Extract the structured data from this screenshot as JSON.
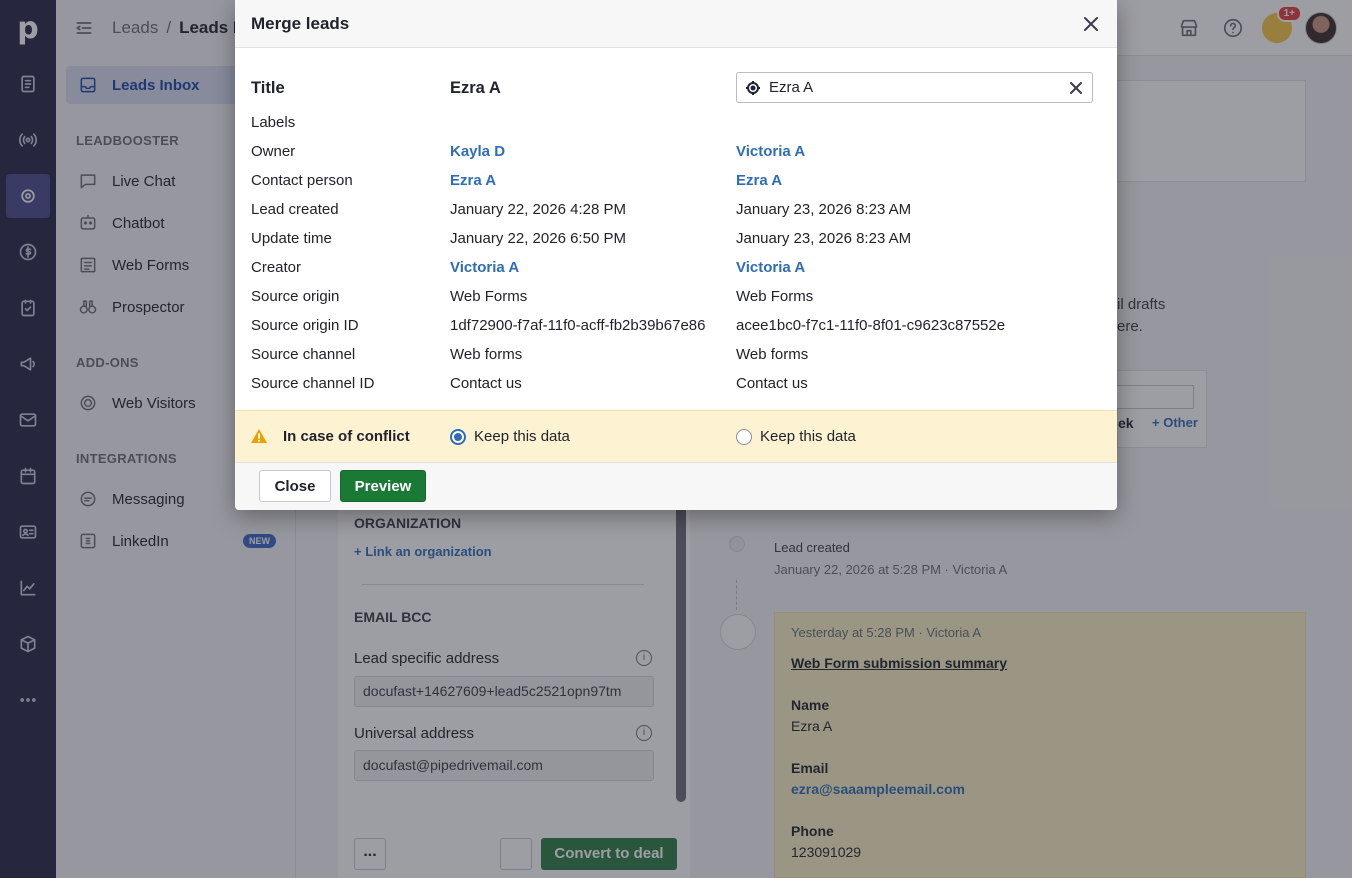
{
  "app": {
    "logo": "p",
    "breadcrumb": {
      "parent": "Leads",
      "separator": "/",
      "current": "Leads In"
    },
    "notification_count": "1+"
  },
  "sidebar": {
    "inbox": "Leads Inbox",
    "leadbooster_title": "LEADBOOSTER",
    "leadbooster_items": [
      "Live Chat",
      "Chatbot",
      "Web Forms",
      "Prospector"
    ],
    "addons_title": "ADD-ONS",
    "addons_items": [
      "Web Visitors"
    ],
    "integrations_title": "INTEGRATIONS",
    "integrations_items": [
      "Messaging",
      "LinkedIn"
    ],
    "new_badge": "NEW"
  },
  "background": {
    "organization_title": "ORGANIZATION",
    "link_org": "+ Link an organization",
    "email_bcc_title": "EMAIL BCC",
    "lead_specific_label": "Lead specific address",
    "lead_specific_value": "docufast+14627609+lead5c2521opn97tm",
    "universal_label": "Universal address",
    "universal_value": "docufast@pipedrivemail.com",
    "more_button": "...",
    "convert_button": "Convert to deal",
    "drafts_text_1": "il drafts",
    "drafts_text_2": "ere.",
    "week_button": "ek",
    "other_link": "+ Other",
    "lead_created_label": "Lead created",
    "lead_created_meta": "January 22, 2026 at 5:28 PM · Victoria A",
    "note_meta": "Yesterday at 5:28 PM · Victoria A",
    "note_title": "Web Form submission summary",
    "name_label": "Name",
    "name_value": "Ezra A",
    "email_label": "Email",
    "email_value": "ezra@saaampleemail.com",
    "phone_label": "Phone",
    "phone_value": "123091029"
  },
  "modal": {
    "title": "Merge leads",
    "search_value": "Ezra A",
    "rows": [
      {
        "label": "Title",
        "left": "Ezra A",
        "right": ""
      },
      {
        "label": "Labels",
        "left": "",
        "right": ""
      },
      {
        "label": "Owner",
        "left": "Kayla D",
        "right": "Victoria A"
      },
      {
        "label": "Contact person",
        "left": "Ezra A",
        "right": "Ezra A"
      },
      {
        "label": "Lead created",
        "left": "January 22, 2026 4:28 PM",
        "right": "January 23, 2026 8:23 AM"
      },
      {
        "label": "Update time",
        "left": "January 22, 2026 6:50 PM",
        "right": "January 23, 2026 8:23 AM"
      },
      {
        "label": "Creator",
        "left": "Victoria A",
        "right": "Victoria A"
      },
      {
        "label": "Source origin",
        "left": "Web Forms",
        "right": "Web Forms"
      },
      {
        "label": "Source origin ID",
        "left": "1df72900-f7af-11f0-acff-fb2b39b67e86",
        "right": "acee1bc0-f7c1-11f0-8f01-c9623c87552e"
      },
      {
        "label": "Source channel",
        "left": "Web forms",
        "right": "Web forms"
      },
      {
        "label": "Source channel ID",
        "left": "Contact us",
        "right": "Contact us"
      }
    ],
    "conflict_label": "In case of conflict",
    "keep_left": "Keep this data",
    "keep_right": "Keep this data",
    "keep_selected": "left",
    "close_button": "Close",
    "preview_button": "Preview"
  },
  "colors": {
    "rail": "#27264a",
    "accent": "#2f6db8",
    "primary": "#1a7a35",
    "conflict_bg": "#fdf3d2"
  }
}
